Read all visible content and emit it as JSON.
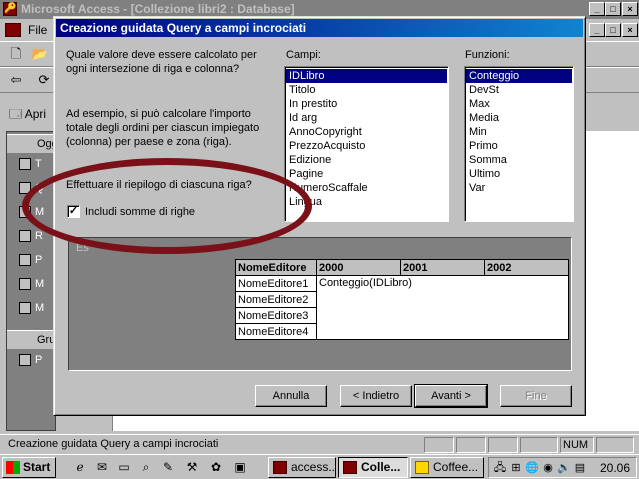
{
  "app": {
    "title": "Microsoft Access - [Collezione libri2 : Database]",
    "menu_file": "File",
    "db_open_label": "Apri",
    "db_objects_label": "Ogg",
    "db_groups_label": "Gru",
    "db_items": [
      "T",
      "Q",
      "M",
      "R",
      "P",
      "M",
      "M"
    ],
    "group_item": "P",
    "restore_label": "_",
    "win_min": "_",
    "win_max": "□",
    "win_close": "×"
  },
  "status": {
    "text": "Creazione guidata Query a campi incrociati",
    "num": "NUM"
  },
  "taskbar": {
    "start": "Start",
    "tasks": [
      {
        "label": "access...",
        "active": false
      },
      {
        "label": "Colle...",
        "active": true
      },
      {
        "label": "Coffee...",
        "active": false
      }
    ],
    "clock": "20.06"
  },
  "wizard": {
    "title": "Creazione guidata Query a campi incrociati",
    "question": "Quale valore deve essere calcolato per ogni intersezione di riga e colonna?",
    "example": "Ad esempio, si può calcolare l'importo totale degli ordini per ciascun impiegato (colonna) per paese e zona (riga).",
    "summary_question": "Effettuare il riepilogo di ciascuna riga?",
    "checkbox_label": "Includi somme di righe",
    "checkbox_checked": true,
    "fields_label": "Campi:",
    "fields": [
      "IDLibro",
      "Titolo",
      "In prestito",
      "Id arg",
      "AnnoCopyright",
      "PrezzoAcquisto",
      "Edizione",
      "Pagine",
      "NumeroScaffale",
      "Lingua"
    ],
    "functions_label": "Funzioni:",
    "functions": [
      "Conteggio",
      "DevSt",
      "Max",
      "Media",
      "Min",
      "Primo",
      "Somma",
      "Ultimo",
      "Var"
    ],
    "preview_label": "Es",
    "grid": {
      "headers": [
        "NomeEditore",
        "2000",
        "2001",
        "2002"
      ],
      "rows": [
        "NomeEditore1",
        "NomeEditore2",
        "NomeEditore3",
        "NomeEditore4"
      ],
      "cell_value": "Conteggio(IDLibro)"
    },
    "buttons": {
      "cancel": "Annulla",
      "back": "< Indietro",
      "next": "Avanti >",
      "finish": "Fine"
    }
  },
  "colors": {
    "highlight_ellipse": "#7a1018",
    "title_active": "#000080"
  }
}
